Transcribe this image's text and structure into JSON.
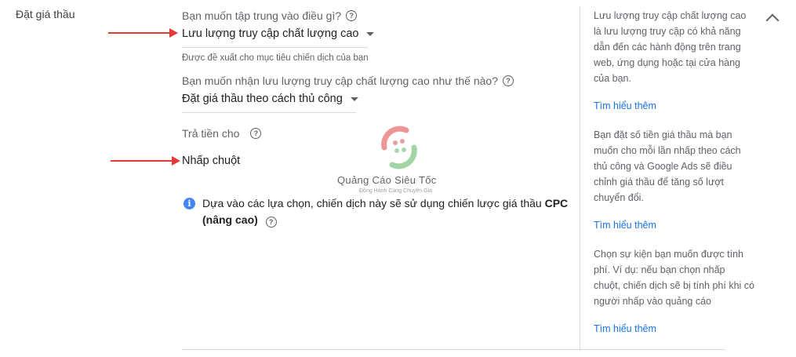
{
  "section": {
    "title": "Đặt giá thầu"
  },
  "focus": {
    "question": "Bạn muốn tập trung vào điều gì?",
    "value": "Lưu lượng truy cập chất lượng cao",
    "hint": "Được đề xuất cho mục tiêu chiến dịch của bạn"
  },
  "method": {
    "question": "Bạn muốn nhận lưu lượng truy cập chất lượng cao như thế nào?",
    "value": "Đặt giá thầu theo cách thủ công"
  },
  "pay": {
    "question": "Trả tiền cho",
    "value": "Nhấp chuột"
  },
  "info": {
    "text": "Dựa vào các lựa chọn, chiến dịch này sẽ sử dụng chiến lược giá thầu ",
    "strong1": "CPC",
    "strong2": "(nâng cao)"
  },
  "sidebar": {
    "block1": "Lưu lượng truy cập chất lượng cao là lưu lượng truy cập có khả năng dẫn đến các hành động trên trang web, ứng dụng hoặc tại cửa hàng của bạn.",
    "link1": "Tìm hiểu thêm",
    "block2": "Bạn đặt số tiền giá thầu mà bạn muốn cho mỗi lần nhấp theo cách thủ công và Google Ads sẽ điều chỉnh giá thầu để tăng số lượt chuyển đổi.",
    "link2": "Tìm hiểu thêm",
    "block3": "Chọn sự kiện bạn muốn được tính phí. Ví dụ: nếu bạn chọn nhấp chuột, chiến dịch sẽ bị tính phí khi có người nhấp vào quảng cáo",
    "link3": "Tìm hiểu thêm"
  },
  "watermark": {
    "name": "Quảng Cáo Siêu Tốc",
    "tagline": "Đồng Hành Cùng Chuyên Gia"
  },
  "icons": {
    "help": "question-circle-icon",
    "info": "info-icon",
    "collapse": "chevron-up-icon"
  },
  "colors": {
    "accent": "#1a73e8",
    "annotation": "#e53935",
    "info": "#4285f4"
  }
}
